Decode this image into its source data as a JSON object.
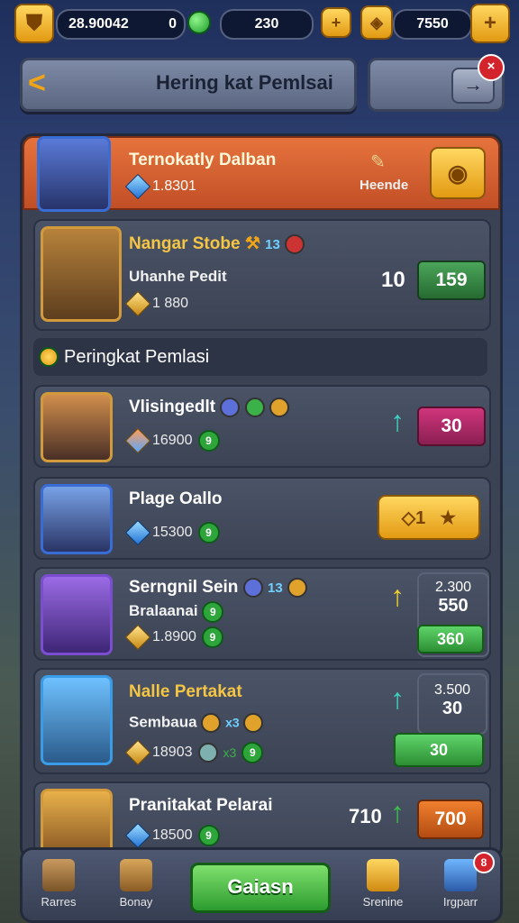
{
  "topbar": {
    "coins": "28.90042",
    "coins_extra": "0",
    "level": "230",
    "gems": "7550",
    "add_button": "+"
  },
  "header": {
    "title": "Hering kat Pemlsai",
    "back": "<",
    "exit": "→",
    "close": "×"
  },
  "featured": {
    "name": "Ternokatly Dalban",
    "stat": "1.8301",
    "label": "Heende"
  },
  "top_player": {
    "name": "Nangar Stobe",
    "name_badge": "13",
    "sub": "Uhanhe Pedit",
    "stat": "1 880",
    "rank": "10",
    "score": "159"
  },
  "section": {
    "title": "Peringkat Pemlasi"
  },
  "players": [
    {
      "name": "Vlisingedlt",
      "stat": "16900",
      "badge": "9",
      "score": "30",
      "extra": "",
      "extra2": ""
    },
    {
      "name": "Plage Oallo",
      "stat": "15300",
      "badge": "9",
      "score": "◇1",
      "extra": "",
      "extra2": ""
    },
    {
      "name": "Serngnil Sein",
      "name_badge": "13",
      "sub": "Bralaanai",
      "stat": "1.8900",
      "badge": "9",
      "extra": "2.300",
      "extra2": "550",
      "score": "360"
    },
    {
      "name": "Nalle Pertakat",
      "name_badge": "x3",
      "sub": "Sembaua",
      "stat": "18903",
      "stat_badge": "x3",
      "badge": "9",
      "extra": "3.500",
      "extra2": "30",
      "score": "30"
    },
    {
      "name": "Pranitakat Pelarai",
      "stat": "18500",
      "badge": "9",
      "rank": "710",
      "score": "700",
      "extra": "",
      "extra2": ""
    }
  ],
  "bottom_nav": {
    "items": [
      "Rarres",
      "Bonay",
      "Srenine",
      "Irgparr"
    ],
    "play": "Gaiasn",
    "badge": "8"
  }
}
